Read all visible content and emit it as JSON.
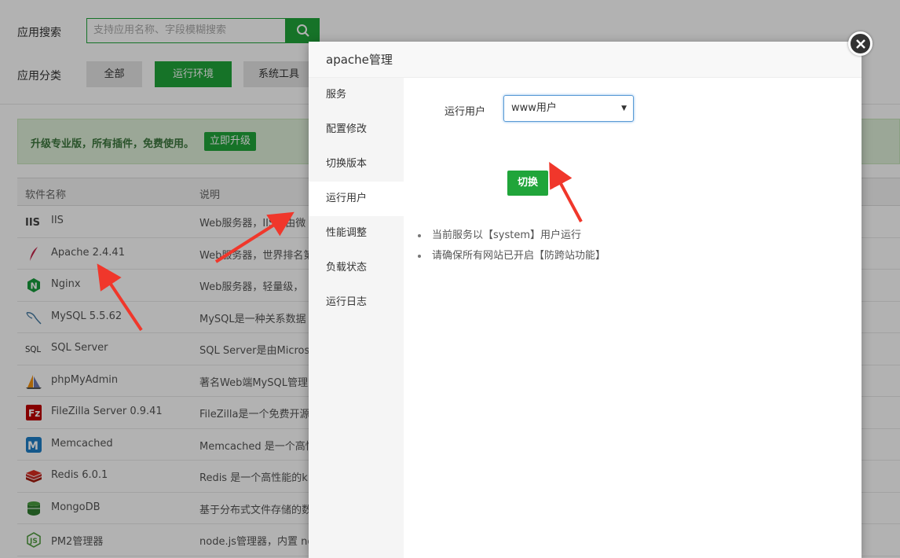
{
  "header": {
    "search_label": "应用搜索",
    "search_placeholder": "支持应用名称、字段模糊搜索",
    "category_label": "应用分类",
    "categories": [
      {
        "label": "全部"
      },
      {
        "label": "运行环境"
      },
      {
        "label": "系统工具"
      }
    ]
  },
  "promo": {
    "text": "升级专业版，所有插件，免费使用。",
    "button": "立即升级"
  },
  "table": {
    "columns": [
      "软件名称",
      "说明"
    ],
    "rows": [
      {
        "name": "IIS",
        "desc": "Web服务器，IIS是由微",
        "icon": "iis-icon"
      },
      {
        "name": "Apache 2.4.41",
        "desc": "Web服务器，世界排名第",
        "icon": "apache-feather-icon"
      },
      {
        "name": "Nginx",
        "desc": "Web服务器，轻量级，",
        "icon": "nginx-icon"
      },
      {
        "name": "MySQL 5.5.62",
        "desc": "MySQL是一种关系数据",
        "icon": "mysql-dolphin-icon"
      },
      {
        "name": "SQL Server",
        "desc": "SQL Server是由Microso",
        "icon": "sql-server-icon"
      },
      {
        "name": "phpMyAdmin",
        "desc": "著名Web端MySQL管理",
        "icon": "phpmyadmin-icon"
      },
      {
        "name": "FileZilla Server 0.9.41",
        "desc": "FileZilla是一个免费开源",
        "icon": "filezilla-icon"
      },
      {
        "name": "Memcached",
        "desc": "Memcached 是一个高性",
        "icon": "memcached-icon"
      },
      {
        "name": "Redis 6.0.1",
        "desc": "Redis 是一个高性能的k",
        "icon": "redis-icon"
      },
      {
        "name": "MongoDB",
        "desc": "基于分布式文件存储的数",
        "icon": "mongodb-icon"
      },
      {
        "name": "PM2管理器",
        "desc": "node.js管理器，内置 no",
        "icon": "nodejs-icon"
      }
    ]
  },
  "modal": {
    "title": "apache管理",
    "side_items": [
      {
        "label": "服务"
      },
      {
        "label": "配置修改"
      },
      {
        "label": "切换版本"
      },
      {
        "label": "运行用户"
      },
      {
        "label": "性能调整"
      },
      {
        "label": "负载状态"
      },
      {
        "label": "运行日志"
      }
    ],
    "active_index": 3,
    "form_label": "运行用户",
    "select_value": "www用户",
    "switch_button": "切换",
    "notes": [
      "当前服务以【system】用户运行",
      "请确保所有网站已开启【防跨站功能】"
    ]
  },
  "colors": {
    "brand_green": "#20a53a",
    "annotation_red": "#f0372b"
  }
}
